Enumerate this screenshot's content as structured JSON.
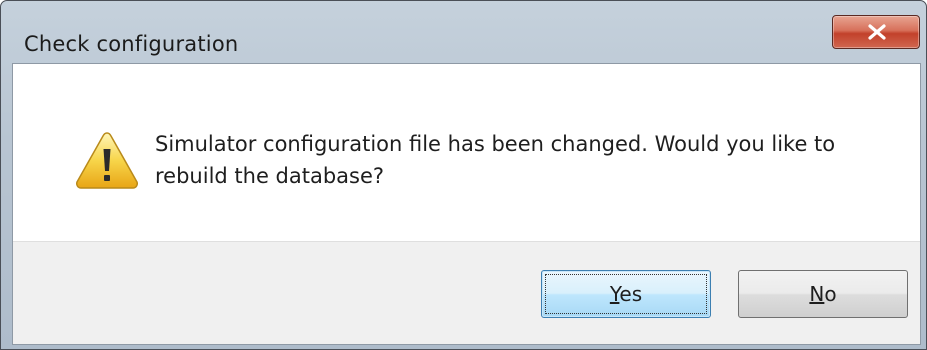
{
  "dialog": {
    "title": "Check configuration",
    "close_icon": "close-x-icon",
    "message": "Simulator configuration file has been changed. Would you like to rebuild the database?",
    "icon": "warning-icon"
  },
  "buttons": {
    "yes": {
      "mnemonic": "Y",
      "rest": "es"
    },
    "no": {
      "mnemonic": "N",
      "rest": "o"
    }
  },
  "colors": {
    "close_button": "#c2412b",
    "warning_fill": "#f4c430",
    "focused_button": "#bee6fd"
  }
}
